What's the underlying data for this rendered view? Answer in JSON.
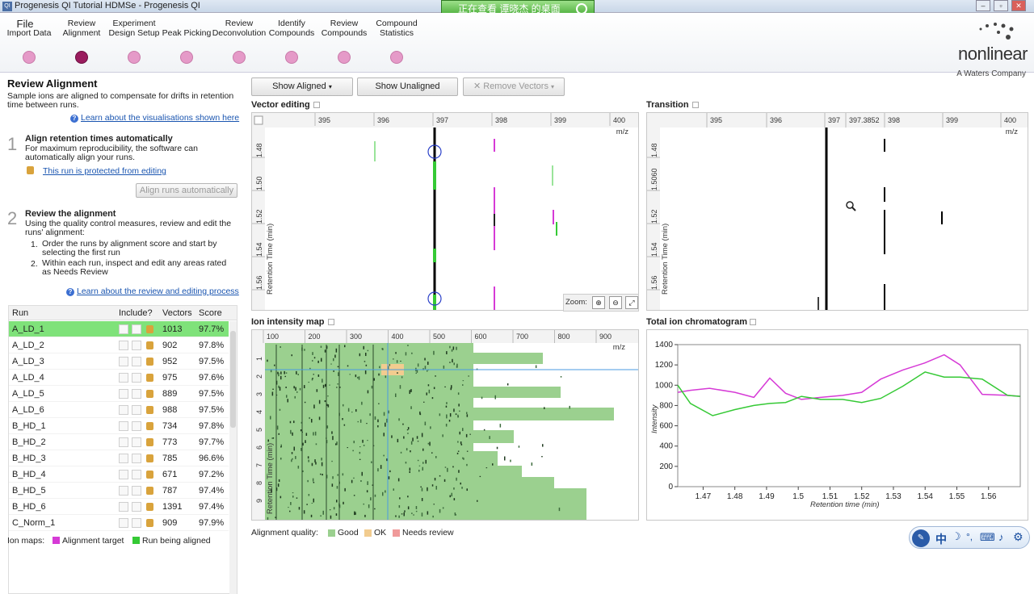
{
  "window": {
    "title": "Progenesis QI Tutorial HDMSe - Progenesis QI",
    "remote_banner": "正在查看 谭晓杰 的桌面"
  },
  "menu": {
    "file": "File"
  },
  "workflow": [
    {
      "label": "Import Data",
      "active": false
    },
    {
      "label": "Review Alignment",
      "active": true
    },
    {
      "label": "Experiment Design Setup",
      "active": false
    },
    {
      "label": "Peak Picking",
      "active": false
    },
    {
      "label": "Review Deconvolution",
      "active": false
    },
    {
      "label": "Identify Compounds",
      "active": false
    },
    {
      "label": "Review Compounds",
      "active": false
    },
    {
      "label": "Compound Statistics",
      "active": false
    }
  ],
  "brand": {
    "name": "nonlinear",
    "sub": "A Waters Company"
  },
  "left": {
    "title": "Review Alignment",
    "intro": "Sample ions are aligned to compensate for drifts in retention time between runs.",
    "help_link": "Learn about the visualisations shown here",
    "step1": {
      "num": "1",
      "title": "Align retention times automatically",
      "text": "For maximum reproducibility, the software can automatically align your runs.",
      "protected_link": "This run is protected from editing",
      "button": "Align runs automatically"
    },
    "step2": {
      "num": "2",
      "title": "Review the alignment",
      "text": "Using the quality control measures, review and edit the runs' alignment:",
      "item1": "Order the runs by alignment score and start by selecting the first run",
      "item2": "Within each run, inspect and edit any areas rated as Needs Review",
      "link": "Learn about the review and editing process"
    },
    "table": {
      "headers": [
        "Run",
        "Include?",
        "Vectors",
        "Score"
      ],
      "rows": [
        {
          "run": "A_LD_1",
          "vectors": "1013",
          "score": "97.7%"
        },
        {
          "run": "A_LD_2",
          "vectors": "902",
          "score": "97.8%"
        },
        {
          "run": "A_LD_3",
          "vectors": "952",
          "score": "97.5%"
        },
        {
          "run": "A_LD_4",
          "vectors": "975",
          "score": "97.6%"
        },
        {
          "run": "A_LD_5",
          "vectors": "889",
          "score": "97.5%"
        },
        {
          "run": "A_LD_6",
          "vectors": "988",
          "score": "97.5%"
        },
        {
          "run": "B_HD_1",
          "vectors": "734",
          "score": "97.8%"
        },
        {
          "run": "B_HD_2",
          "vectors": "773",
          "score": "97.7%"
        },
        {
          "run": "B_HD_3",
          "vectors": "785",
          "score": "96.6%"
        },
        {
          "run": "B_HD_4",
          "vectors": "671",
          "score": "97.2%"
        },
        {
          "run": "B_HD_5",
          "vectors": "787",
          "score": "97.4%"
        },
        {
          "run": "B_HD_6",
          "vectors": "1391",
          "score": "97.4%"
        },
        {
          "run": "C_Norm_1",
          "vectors": "909",
          "score": "97.9%"
        }
      ]
    },
    "legend": {
      "label": "Ion maps:",
      "target": "Alignment target",
      "aligned": "Run being aligned"
    }
  },
  "toolbar2": {
    "show_aligned": "Show Aligned",
    "show_unaligned": "Show Unaligned",
    "remove_vectors": "Remove Vectors"
  },
  "vector": {
    "title": "Vector editing",
    "mz_ticks": [
      "395",
      "396",
      "397",
      "398",
      "399",
      "400"
    ],
    "rt_ticks": [
      "1.48",
      "1.50",
      "1.52",
      "1.54",
      "1.56"
    ],
    "mz_label": "m/z",
    "rt_label": "Retention Time (min)",
    "zoom": "Zoom:"
  },
  "transition": {
    "title": "Transition",
    "mz_ticks": [
      "395",
      "396",
      "397",
      "397.3852",
      "398",
      "399",
      "400"
    ],
    "rt_ticks": [
      "1.48",
      "1.5060",
      "1.52",
      "1.54",
      "1.56"
    ],
    "mz_label": "m/z",
    "rt_label": "Retention Time (min)"
  },
  "ionmap": {
    "title": "Ion intensity map",
    "mz_ticks": [
      "100",
      "200",
      "300",
      "400",
      "500",
      "600",
      "700",
      "800",
      "900"
    ],
    "rt_ticks": [
      "1",
      "2",
      "3",
      "4",
      "5",
      "6",
      "7",
      "8",
      "9"
    ],
    "mz_label": "m/z",
    "rt_label": "Retention Time (min)"
  },
  "quality": {
    "label": "Alignment quality:",
    "good": "Good",
    "ok": "OK",
    "needs": "Needs review",
    "colors": {
      "good": "#9bd08f",
      "ok": "#f2cc8f",
      "needs": "#f09a9a"
    }
  },
  "tic": {
    "title": "Total ion chromatogram",
    "chart_data": {
      "type": "line",
      "xlabel": "Retention time (min)",
      "ylabel": "Intensity",
      "xlim": [
        1.462,
        1.57
      ],
      "ylim": [
        0,
        1400
      ],
      "x_ticks": [
        "1.47",
        "1.48",
        "1.49",
        "1.5",
        "1.51",
        "1.52",
        "1.53",
        "1.54",
        "1.55",
        "1.56"
      ],
      "y_ticks": [
        "0",
        "200",
        "400",
        "600",
        "800",
        "1000",
        "1200",
        "1400"
      ],
      "series": [
        {
          "color": "#d63ad6",
          "x": [
            1.462,
            1.466,
            1.472,
            1.48,
            1.486,
            1.491,
            1.496,
            1.501,
            1.507,
            1.514,
            1.52,
            1.526,
            1.533,
            1.54,
            1.546,
            1.551,
            1.558,
            1.566,
            1.57
          ],
          "y": [
            930,
            950,
            970,
            930,
            880,
            1070,
            920,
            860,
            880,
            900,
            930,
            1060,
            1150,
            1220,
            1300,
            1200,
            910,
            900,
            890
          ]
        },
        {
          "color": "#35c935",
          "x": [
            1.462,
            1.466,
            1.473,
            1.48,
            1.486,
            1.491,
            1.496,
            1.501,
            1.507,
            1.514,
            1.52,
            1.526,
            1.533,
            1.54,
            1.546,
            1.551,
            1.558,
            1.566,
            1.57
          ],
          "y": [
            1000,
            820,
            700,
            760,
            800,
            820,
            830,
            890,
            860,
            860,
            830,
            870,
            990,
            1130,
            1080,
            1080,
            1060,
            900,
            890
          ]
        }
      ]
    }
  },
  "taskbar": {
    "ime": "中"
  }
}
